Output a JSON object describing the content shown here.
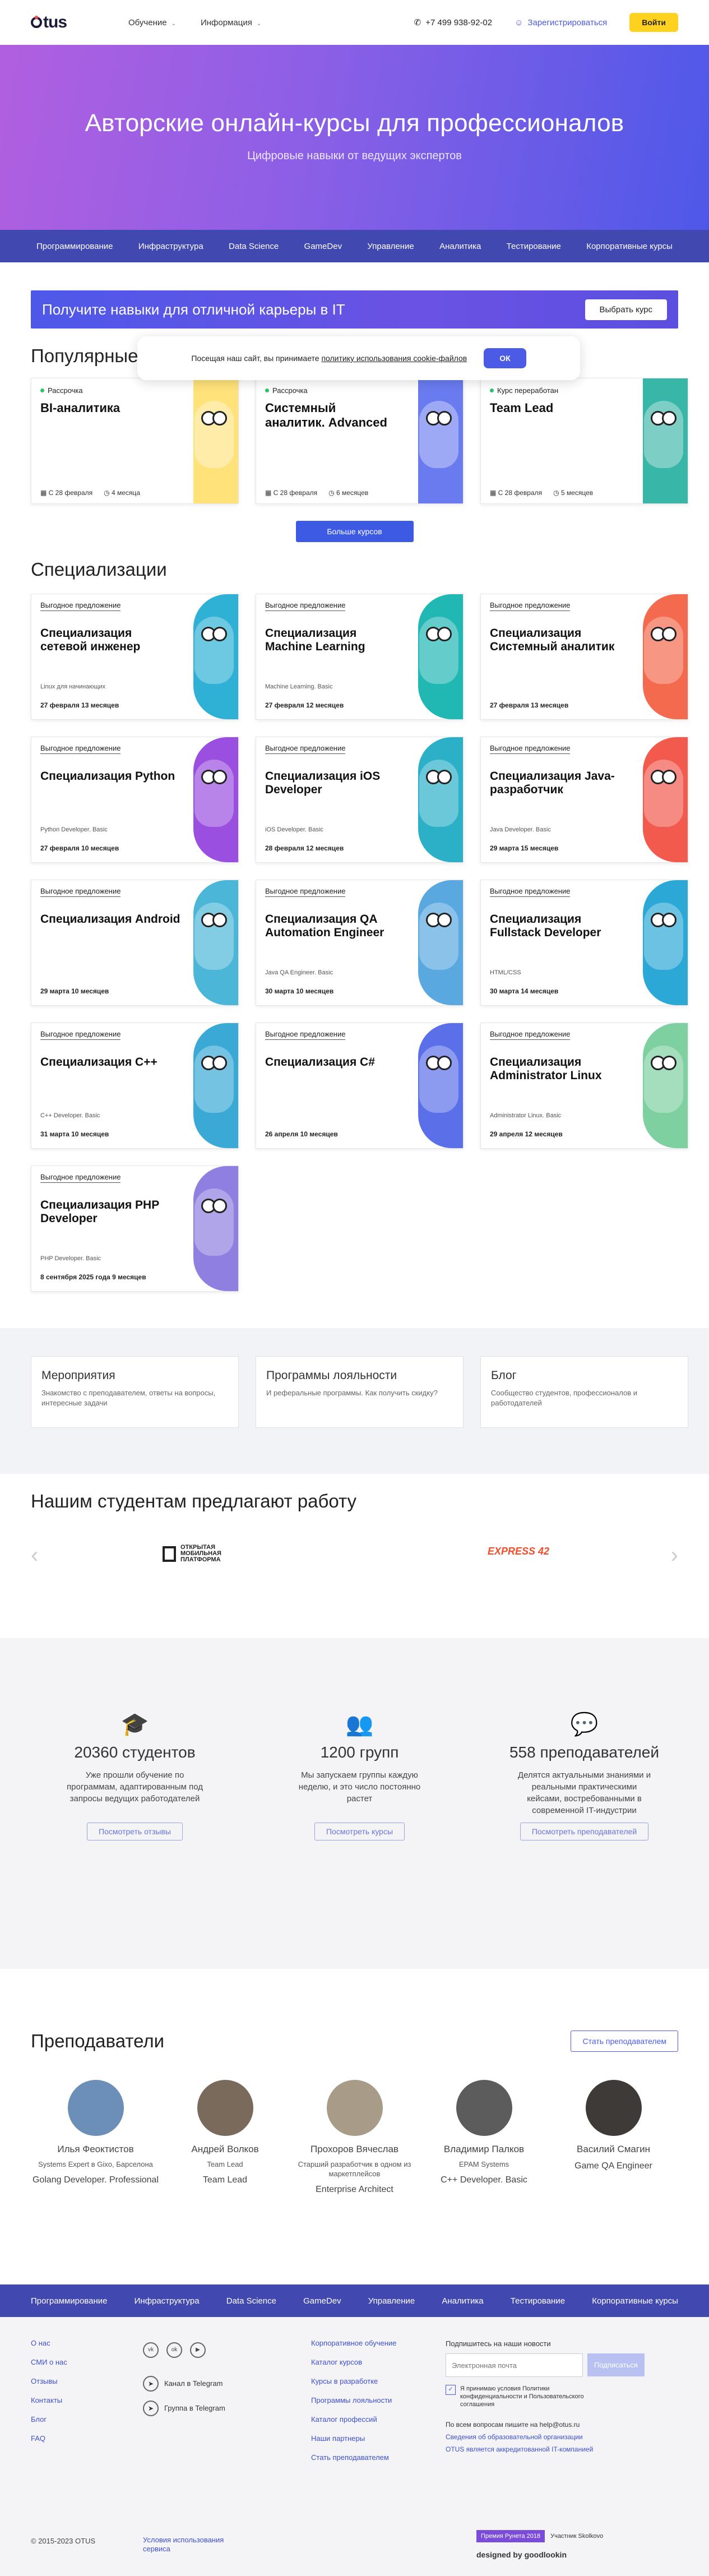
{
  "header": {
    "logo": "OTUS",
    "menu": [
      {
        "label": "Обучение"
      },
      {
        "label": "Информация"
      }
    ],
    "phone": "+7 499 938-92-02",
    "register": "Зарегистрироваться",
    "login": "Войти"
  },
  "hero": {
    "title": "Авторские онлайн-курсы для профессионалов",
    "subtitle": "Цифровые навыки от ведущих экспертов"
  },
  "categories": [
    "Программирование",
    "Инфраструктура",
    "Data Science",
    "GameDev",
    "Управление",
    "Аналитика",
    "Тестирование",
    "Корпоративные курсы"
  ],
  "banner": {
    "text": "Получите навыки для отличной карьеры в IT",
    "button": "Выбрать курс"
  },
  "cookie": {
    "text": "Посещая наш сайт, вы принимаете",
    "link": "политику использования cookie-файлов",
    "ok": "ОК"
  },
  "popular": {
    "title": "Популярные",
    "cards": [
      {
        "tag": "Рассрочка",
        "title": "BI-аналитика",
        "date": "С 28 февраля",
        "duration": "4 месяца",
        "color": "#ffe27a"
      },
      {
        "tag": "Рассрочка",
        "title": "Системный аналитик. Advanced",
        "date": "С 28 февраля",
        "duration": "6 месяцев",
        "color": "#6a7bf0"
      },
      {
        "tag": "Курс переработан",
        "title": "Team Lead",
        "date": "С 28 февраля",
        "duration": "5 месяцев",
        "color": "#38b6a8"
      }
    ],
    "more": "Больше курсов"
  },
  "specs": {
    "title": "Специализации",
    "deal": "Выгодное предложение",
    "cards": [
      {
        "title": "Специализация сетевой инженер",
        "sub": "Linux для начинающих",
        "when": "27 февраля 13 месяцев",
        "color": "#2fb1d6"
      },
      {
        "title": "Специализация Machine Learning",
        "sub": "Machine Learning. Basic",
        "when": "27 февраля 12 месяцев",
        "color": "#21b7b3"
      },
      {
        "title": "Специализация Системный аналитик",
        "sub": "",
        "when": "27 февраля 13 месяцев",
        "color": "#f46a4e"
      },
      {
        "title": "Специализация Python",
        "sub": "Python Developer. Basic",
        "when": "27 февраля 10 месяцев",
        "color": "#9b4fe0"
      },
      {
        "title": "Специализация iOS Developer",
        "sub": "iOS Developer. Basic",
        "when": "28 февраля 12 месяцев",
        "color": "#2bb0c8"
      },
      {
        "title": "Специализация Java-разработчик",
        "sub": "Java Developer. Basic",
        "when": "29 марта 15 месяцев",
        "color": "#f25a4e"
      },
      {
        "title": "Специализация Android",
        "sub": "",
        "when": "29 марта 10 месяцев",
        "color": "#4cb6d8"
      },
      {
        "title": "Специализация QA Automation Engineer",
        "sub": "Java QA Engineer. Basic",
        "when": "30 марта 10 месяцев",
        "color": "#5aa8e0"
      },
      {
        "title": "Специализация Fullstack Developer",
        "sub": "HTML/CSS",
        "when": "30 марта 14 месяцев",
        "color": "#2ba8d6"
      },
      {
        "title": "Специализация C++",
        "sub": "C++ Developer. Basic",
        "when": "31 марта 10 месяцев",
        "color": "#3aa9d6"
      },
      {
        "title": "Специализация C#",
        "sub": "",
        "when": "26 апреля 10 месяцев",
        "color": "#5b6fe8"
      },
      {
        "title": "Специализация Administrator Linux",
        "sub": "Administrator Linux. Basic",
        "when": "29 апреля 12 месяцев",
        "color": "#7fd0a0"
      },
      {
        "title": "Специализация PHP Developer",
        "sub": "PHP Developer. Basic",
        "when": "8 сентября 2025 года 9 месяцев",
        "color": "#8f7fe0"
      }
    ]
  },
  "info": [
    {
      "title": "Мероприятия",
      "text": "Знакомство с преподавателем, ответы на вопросы, интересные задачи"
    },
    {
      "title": "Программы лояльности",
      "text": "И реферальные программы. Как получить скидку?"
    },
    {
      "title": "Блог",
      "text": "Сообщество студентов, профессионалов и работодателей"
    }
  ],
  "jobs": {
    "title": "Нашим студентам предлагают работу",
    "partners": [
      "ОТКРЫТАЯ МОБИЛЬНАЯ ПЛАТФОРМА",
      "EXPRESS 42"
    ]
  },
  "stats": [
    {
      "icon": "graduation-cap-icon",
      "value": "20360 студентов",
      "text": "Уже прошли обучение по программам, адаптированным под запросы ведущих работодателей",
      "btn": "Посмотреть отзывы"
    },
    {
      "icon": "group-icon",
      "value": "1200 групп",
      "text": "Мы запускаем группы каждую неделю, и это число постоянно растет",
      "btn": "Посмотреть курсы"
    },
    {
      "icon": "chat-icon",
      "value": "558 преподавателей",
      "text": "Делятся актуальными знаниями и реальными практическими кейсами, востребованными в современной IT-индустрии",
      "btn": "Посмотреть преподавателей"
    }
  ],
  "teachers": {
    "title": "Преподаватели",
    "become": "Стать преподавателем",
    "list": [
      {
        "name": "Илья Феоктистов",
        "company": "Systems Expert в Gixo, Барселона",
        "role": "Golang Developer. Professional"
      },
      {
        "name": "Андрей Волков",
        "company": "Team Lead",
        "role": "Team Lead"
      },
      {
        "name": "Прохоров Вячеслав",
        "company": "Старший разработчик в одном из маркетплейсов",
        "role": "Enterprise Architect"
      },
      {
        "name": "Владимир Палков",
        "company": "EPAM Systems",
        "role": "C++ Developer. Basic"
      },
      {
        "name": "Василий Смагин",
        "company": "",
        "role": "Game QA Engineer"
      }
    ]
  },
  "footer": {
    "col1": [
      "О нас",
      "СМИ о нас",
      "Отзывы",
      "Контакты",
      "Блог",
      "FAQ"
    ],
    "telegram": [
      "Канал в Telegram",
      "Группа в Telegram"
    ],
    "col3": [
      "Корпоративное обучение",
      "Каталог курсов",
      "Курсы в разработке",
      "Программы лояльности",
      "Каталог профессий",
      "Наши партнеры",
      "Стать преподавателем"
    ],
    "news_title": "Подпишитесь на наши новости",
    "email_placeholder": "Электронная почта",
    "subscribe": "Подписаться",
    "agree": "Я принимаю условия Политики конфиденциальности и Пользовательского соглашения",
    "contact": "По всем вопросам пишите на help@otus.ru",
    "edu": "Сведения об образовательной организации",
    "accr": "OTUS является аккредитованной IT-компанией",
    "copyright": "© 2015-2023 OTUS",
    "terms": "Условия использования сервиса",
    "award": "Премия Рунета 2018",
    "skolkovo": "Участник Skolkovo",
    "designed": "designed by goodlookin"
  }
}
